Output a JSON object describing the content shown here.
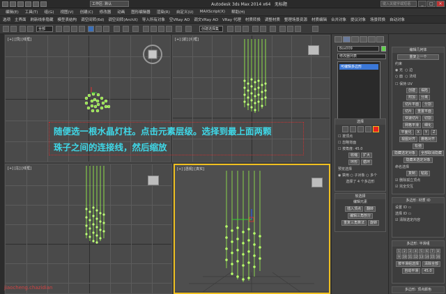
{
  "titlebar": {
    "workspace": "工作区: 默认",
    "app_title": "Autodesk 3ds Max  2014 x64",
    "doc_title": "无标题",
    "search_placeholder": "键入关键字或短语"
  },
  "menubar": [
    "编辑(E)",
    "工具(T)",
    "组(G)",
    "视图(V)",
    "创建(C)",
    "修改器",
    "动画",
    "图形编辑器",
    "渲染(R)",
    "自定义(U)",
    "MAXScript(X)",
    "帮助(H)"
  ],
  "ribbon": [
    "选项",
    "主界面",
    "刷新线条隐藏",
    "模型表结构",
    "调空间转(6d)",
    "调空间转(ArchX)",
    "导入所有对象",
    "空VRay AO",
    "调文VRay AO",
    "VRay 代理",
    "材质转换",
    "调整材质",
    "整理场景资源",
    "材质编辑",
    "合并对象",
    "提议对象",
    "场景转换",
    "自动对象",
    "层级VRay"
  ],
  "toolbar": {
    "selection_filter": "全部",
    "sub_dropdown": "创建选择集"
  },
  "viewports": [
    {
      "label": "[+] [顶] [线框]",
      "active": false
    },
    {
      "label": "[+] [前] [线框]",
      "active": false
    },
    {
      "label": "[+] [左] [线框]",
      "active": false
    },
    {
      "label": "[+] [透视] [真实]",
      "active": true
    }
  ],
  "annotation": {
    "line1": "随便选一根水晶灯柱。点击元素层级。选择到最上面两颗",
    "line2": "珠子之间的连接线，然后缩放"
  },
  "command_panel": {
    "object_name": "Box009",
    "object_color": "#5fd24a",
    "modifier_list": "修改器列表",
    "stack_item": "可编辑多边形",
    "selection_rollout": {
      "title": "选择",
      "checks": [
        "按顶点",
        "忽略背面",
        "按角度: 45.0"
      ],
      "buttons": [
        "收缩",
        "扩大",
        "环形",
        "循环"
      ],
      "preview_label": "预览选择",
      "preview_options": [
        "禁用",
        "子对象",
        "多个"
      ],
      "status": "选择了 4 个多边形"
    },
    "soft_rollout": {
      "title": "软选择",
      "subtitle": "编辑元素",
      "buttons": [
        "插入顶点",
        "翻转",
        "编辑三角剖分",
        "重复三角算法",
        "旋转"
      ]
    }
  },
  "edit_panel": {
    "rollout_title": "编辑几何体",
    "repeat_last": "重复上一个",
    "constraint_label": "约束",
    "constraints": [
      "无",
      "边",
      "面",
      "法线"
    ],
    "preserve_uv": "保持 UV",
    "buttons": [
      "创建",
      "塌陷",
      "附加",
      "分离",
      "切片平面",
      "分割",
      "切片",
      "重置平面",
      "快速切片",
      "切割",
      "网格平滑",
      "细化",
      "平面化",
      "X",
      "Y",
      "Z",
      "视图对齐",
      "栅格对齐",
      "松弛",
      "隐藏选定对象",
      "全部取消隐藏",
      "隐藏未选定对象"
    ],
    "named_selection": "命名选择",
    "copy_paste": [
      "复制",
      "粘贴"
    ],
    "delete_isolated": "删除孤立顶点",
    "full_interactive": "完全交互",
    "material_rollout": "多边形: 材质 ID",
    "set_id": "设置 ID",
    "select_id": "选择 ID",
    "clear_selection": "清除选定内容",
    "smoothing_rollout": "多边形: 平滑组",
    "select_by_sg": "按平滑组选择",
    "clear_all": "清除全部",
    "auto_smooth": "自动平滑",
    "auto_smooth_value": "45.0",
    "vertex_color_rollout": "多边形: 顶点颜色"
  },
  "watermark": "jiaocheng.chazidian"
}
